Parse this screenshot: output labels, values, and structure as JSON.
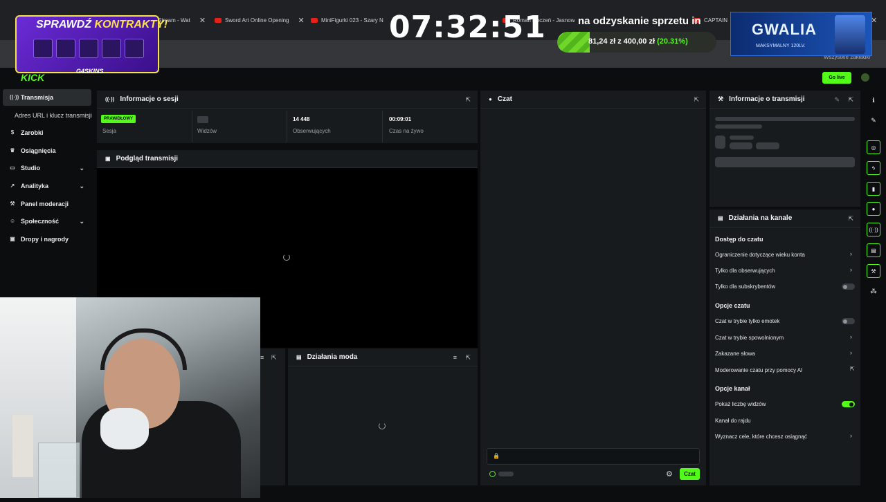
{
  "browser": {
    "tabs": [
      {
        "label": "Stream - Wat"
      },
      {
        "label": "Sword Art Online Opening"
      },
      {
        "label": "MiniFigurki 023 - Szary N"
      },
      {
        "label": "Roman Roczeń - Jasnowł"
      },
      {
        "label": "CAPTAIN"
      }
    ],
    "bookmarks_label": "Wszystkie zakładki"
  },
  "overlay": {
    "clock": "07:32:51",
    "goal_title": "na odzyskanie sprzetu in",
    "goal_amount": "81,24 zł",
    "goal_of": "z",
    "goal_target": "400,00 zł",
    "goal_percent": "(20.31%)",
    "goal_progress": 0.2031,
    "promo_word1": "SPRAWDŹ",
    "promo_word2": "KONTRAKTY!",
    "promo_brand": "G4SKINS",
    "server_name": "GWALIA",
    "server_sub": "MAKSYMALNY 120LV."
  },
  "header": {
    "logo": "KICK",
    "go_live": "Go live"
  },
  "sidebar": {
    "items": [
      {
        "label": "Transmisja",
        "icon": "broadcast-icon"
      },
      {
        "label": "Zarobki",
        "icon": "coin-icon"
      },
      {
        "label": "Osiągnięcia",
        "icon": "trophy-icon"
      },
      {
        "label": "Studio",
        "icon": "studio-icon"
      },
      {
        "label": "Analityka",
        "icon": "chart-icon"
      },
      {
        "label": "Panel moderacji",
        "icon": "wrench-icon"
      },
      {
        "label": "Społeczność",
        "icon": "users-icon"
      },
      {
        "label": "Dropy i nagrody",
        "icon": "gift-icon"
      }
    ],
    "sub_item": "Adres URL i klucz transmisji"
  },
  "session": {
    "title": "Informacje o sesji",
    "status": "PRAWIDŁOWY",
    "stats": [
      {
        "label": "Sesja",
        "value": ""
      },
      {
        "label": "Widzów",
        "value": ""
      },
      {
        "label": "Obserwujących",
        "value": "14 448"
      },
      {
        "label": "Czas na żywo",
        "value": "00:09:01"
      }
    ]
  },
  "preview": {
    "title": "Podgląd transmisji"
  },
  "modactions": {
    "title": "Działania moda"
  },
  "chat": {
    "title": "Czat",
    "send_label": "Czat"
  },
  "stream_info": {
    "title": "Informacje o transmisji"
  },
  "channel_actions": {
    "title": "Działania na kanale",
    "sections": [
      {
        "heading": "Dostęp do czatu",
        "options": [
          {
            "label": "Ograniczenie dotyczące wieku konta",
            "control": "chevron"
          },
          {
            "label": "Tylko dla obserwujących",
            "control": "chevron"
          },
          {
            "label": "Tylko dla subskrybentów",
            "control": "toggle-off"
          }
        ]
      },
      {
        "heading": "Opcje czatu",
        "options": [
          {
            "label": "Czat w trybie tylko emotek",
            "control": "toggle-off"
          },
          {
            "label": "Czat w trybie spowolnionym",
            "control": "chevron"
          },
          {
            "label": "Zakazane słowa",
            "control": "chevron"
          },
          {
            "label": "Moderowanie czatu przy pomocy AI",
            "control": "external"
          }
        ]
      },
      {
        "heading": "Opcje kanał",
        "options": [
          {
            "label": "Pokaż liczbę widzów",
            "control": "toggle-on"
          },
          {
            "label": "Kanał do rajdu",
            "control": "none"
          },
          {
            "label": "Wyznacz cele, które chcesz osiągnąć",
            "control": "chevron"
          }
        ]
      }
    ]
  },
  "colors": {
    "accent": "#53fc18",
    "panel": "#181b1d",
    "background": "#0b0d0e"
  }
}
